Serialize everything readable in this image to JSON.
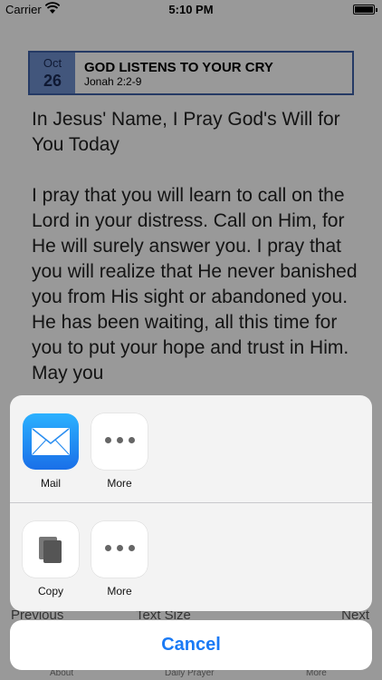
{
  "status_bar": {
    "carrier": "Carrier",
    "time": "5:10 PM"
  },
  "devotion": {
    "month": "Oct",
    "day": "26",
    "title": "GOD LISTENS TO YOUR CRY",
    "reference": "Jonah 2:2-9",
    "paragraphs": [
      "In Jesus' Name, I Pray God's Will for You Today",
      "I pray that you will learn to call on the Lord in your distress. Call on Him, for He will surely answer you. I pray that you will realize that He never banished you from His sight or abandoned you. He has been waiting, all this time for you to put your hope and trust in Him. May you"
    ]
  },
  "toolbar": {
    "previous": "Previous",
    "text_size": "Text Size",
    "next": "Next"
  },
  "tabs": {
    "about": "About",
    "daily_prayer": "Daily Prayer",
    "more": "More"
  },
  "share_sheet": {
    "row1": [
      {
        "label": "Mail",
        "icon": "mail-icon"
      },
      {
        "label": "More",
        "icon": "more-icon"
      }
    ],
    "row2": [
      {
        "label": "Copy",
        "icon": "copy-icon"
      },
      {
        "label": "More",
        "icon": "more-icon"
      }
    ],
    "cancel_label": "Cancel"
  },
  "colors": {
    "accent": "#1a7af5",
    "date_header_border": "#3e62a8",
    "date_box": "#6f8fcf"
  }
}
